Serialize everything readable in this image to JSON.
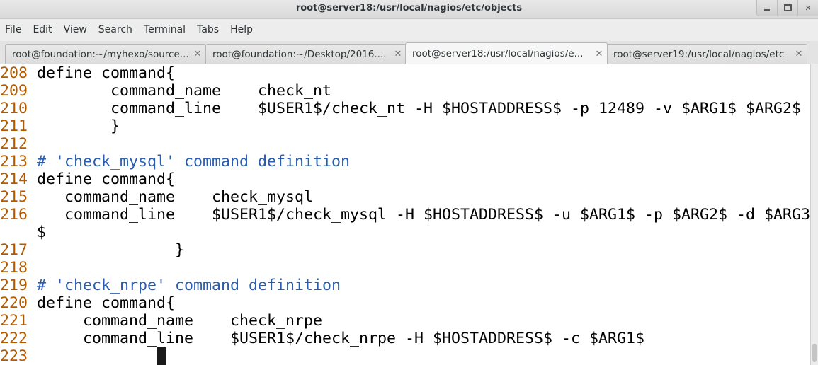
{
  "window": {
    "title": "root@server18:/usr/local/nagios/etc/objects"
  },
  "menu": [
    "File",
    "Edit",
    "View",
    "Search",
    "Terminal",
    "Tabs",
    "Help"
  ],
  "tabs": [
    {
      "label": "root@foundation:~/myhexo/source...",
      "active": false
    },
    {
      "label": "root@foundation:~/Desktop/2016....",
      "active": false
    },
    {
      "label": "root@server18:/usr/local/nagios/e...",
      "active": true
    },
    {
      "label": "root@server19:/usr/local/nagios/etc",
      "active": false
    }
  ],
  "terminal": {
    "lines": [
      {
        "num": "208",
        "code": "define command{"
      },
      {
        "num": "209",
        "code": "        command_name    check_nt"
      },
      {
        "num": "210",
        "code": "        command_line    $USER1$/check_nt -H $HOSTADDRESS$ -p 12489 -v $ARG1$ $ARG2$"
      },
      {
        "num": "211",
        "code": "        }"
      },
      {
        "num": "212",
        "code": ""
      },
      {
        "num": "213",
        "comment": "# 'check_mysql' command definition"
      },
      {
        "num": "214",
        "code": "define command{"
      },
      {
        "num": "215",
        "code": "   command_name    check_mysql"
      },
      {
        "num": "216",
        "code": "   command_line    $USER1$/check_mysql -H $HOSTADDRESS$ -u $ARG1$ -p $ARG2$ -d $ARG3"
      },
      {
        "num": "",
        "code": "$"
      },
      {
        "num": "217",
        "code": "               }"
      },
      {
        "num": "218",
        "code": ""
      },
      {
        "num": "219",
        "comment": "# 'check_nrpe' command definition"
      },
      {
        "num": "220",
        "code": "define command{"
      },
      {
        "num": "221",
        "code": "     command_name    check_nrpe"
      },
      {
        "num": "222",
        "code": "     command_line    $USER1$/check_nrpe -H $HOSTADDRESS$ -c $ARG1$"
      },
      {
        "num": "223",
        "code": "             }",
        "cursor_col": 13
      }
    ]
  },
  "colors": {
    "line_number": "#b35a00",
    "comment": "#2a5db0",
    "text": "#000000",
    "background": "#ffffff"
  },
  "icons": {
    "minimize": "minimize-icon",
    "maximize": "maximize-icon",
    "close": "close-icon",
    "tab_close": "close-icon"
  }
}
